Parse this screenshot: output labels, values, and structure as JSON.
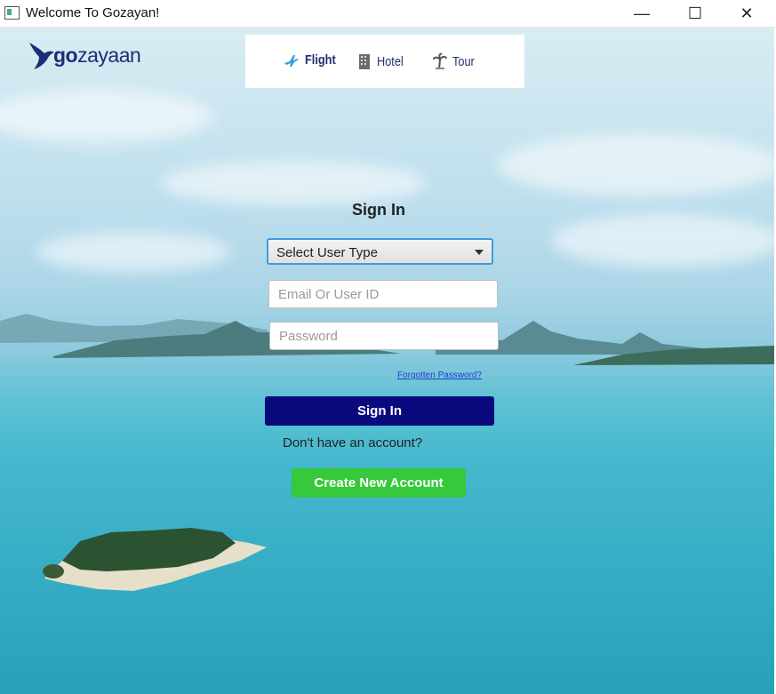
{
  "window": {
    "title": "Welcome To Gozayan!",
    "controls": {
      "minimize": "—",
      "maximize": "☐",
      "close": "✕"
    }
  },
  "logo": {
    "part1": "go",
    "part2": "zayaan"
  },
  "nav": {
    "items": [
      {
        "label": "Flight",
        "icon": "plane-icon"
      },
      {
        "label": "Hotel",
        "icon": "building-icon"
      },
      {
        "label": "Tour",
        "icon": "palm-tree-icon"
      }
    ]
  },
  "form": {
    "title": "Sign In",
    "user_type": {
      "value": "Select User Type"
    },
    "email": {
      "value": "",
      "placeholder": "Email Or User ID"
    },
    "password": {
      "value": "",
      "placeholder": "Password"
    },
    "forgot_link": "Forgotten Password?",
    "signin_button": "Sign In",
    "no_account_text": "Don't have an account?",
    "create_button": "Create New Account"
  },
  "colors": {
    "signin_button": "#0a0a7f",
    "create_button": "#36c93b",
    "link": "#1f3fcf",
    "brand": "#1c2e78"
  }
}
